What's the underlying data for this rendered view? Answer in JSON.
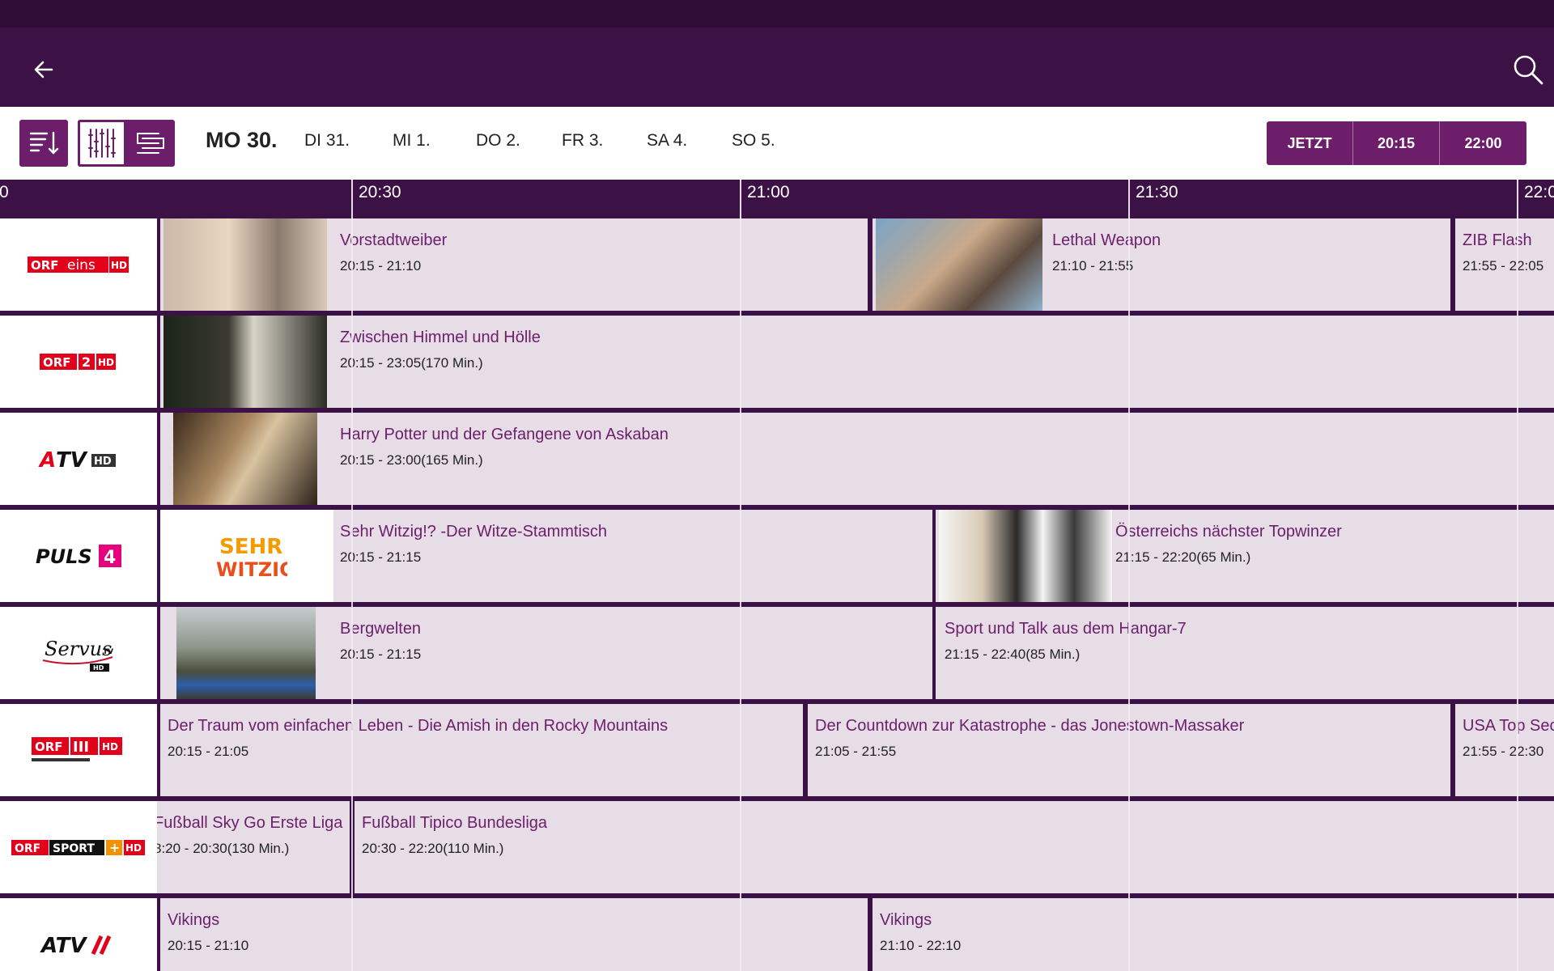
{
  "appbar": {
    "back_icon": "arrow-left-icon",
    "search_icon": "search-icon"
  },
  "toolbar": {
    "days": [
      {
        "label": "MO 30.",
        "selected": true
      },
      {
        "label": "DI 31."
      },
      {
        "label": "MI 1."
      },
      {
        "label": "DO 2."
      },
      {
        "label": "FR 3."
      },
      {
        "label": "SA 4."
      },
      {
        "label": "SO 5."
      }
    ],
    "quick_times": [
      "JETZT",
      "20:15",
      "22:00"
    ]
  },
  "timeline": {
    "ticks": [
      "0",
      "20:30",
      "21:00",
      "21:30",
      "22:0"
    ]
  },
  "channels": [
    {
      "logo": "ORF eins HD",
      "programs": [
        {
          "title": "Vorstadtweiber",
          "time": "20:15 - 21:10"
        },
        {
          "title": "Lethal Weapon",
          "time": "21:10 - 21:55"
        },
        {
          "title": "ZIB Flash",
          "time": "21:55 - 22:05"
        }
      ]
    },
    {
      "logo": "ORF 2 HD",
      "programs": [
        {
          "title": "Zwischen Himmel und Hölle",
          "time": "20:15 - 23:05(170 Min.)"
        }
      ]
    },
    {
      "logo": "ATV HD",
      "programs": [
        {
          "title": "Harry Potter und der Gefangene von Askaban",
          "time": "20:15 - 23:00(165 Min.)"
        }
      ]
    },
    {
      "logo": "PULS 4",
      "programs": [
        {
          "title": "Sehr Witzig!? -Der Witze-Stammtisch",
          "time": "20:15 - 21:15"
        },
        {
          "title": "Österreichs nächster Topwinzer",
          "time": "21:15 - 22:20(65 Min.)"
        }
      ]
    },
    {
      "logo": "ServusTV HD",
      "programs": [
        {
          "title": "Bergwelten",
          "time": "20:15 - 21:15"
        },
        {
          "title": "Sport und Talk aus dem Hangar-7",
          "time": "21:15 - 22:40(85 Min.)"
        }
      ]
    },
    {
      "logo": "ORF III HD",
      "programs": [
        {
          "title": "Der Traum vom einfachen Leben - Die Amish in den Rocky Mountains",
          "time": "20:15 - 21:05"
        },
        {
          "title": "Der Countdown zur Katastrophe - das Jonestown-Massaker",
          "time": "21:05 - 21:55"
        },
        {
          "title": "USA Top Sec",
          "time": "21:55 - 22:30"
        }
      ]
    },
    {
      "logo": "ORF SPORT + HD",
      "programs": [
        {
          "title": "Fußball Sky Go Erste Liga",
          "time": "8:20 - 20:30(130 Min.)"
        },
        {
          "title": "Fußball Tipico Bundesliga",
          "time": "20:30 - 22:20(110 Min.)"
        }
      ]
    },
    {
      "logo": "ATV II",
      "programs": [
        {
          "title": "Vikings",
          "time": "20:15 - 21:10"
        },
        {
          "title": "Vikings",
          "time": "21:10 - 22:10"
        }
      ]
    }
  ],
  "colors": {
    "primary": "#6d1e6b",
    "header": "#3c1145",
    "cell": "#e6dde7",
    "title": "#6d1e6b"
  }
}
